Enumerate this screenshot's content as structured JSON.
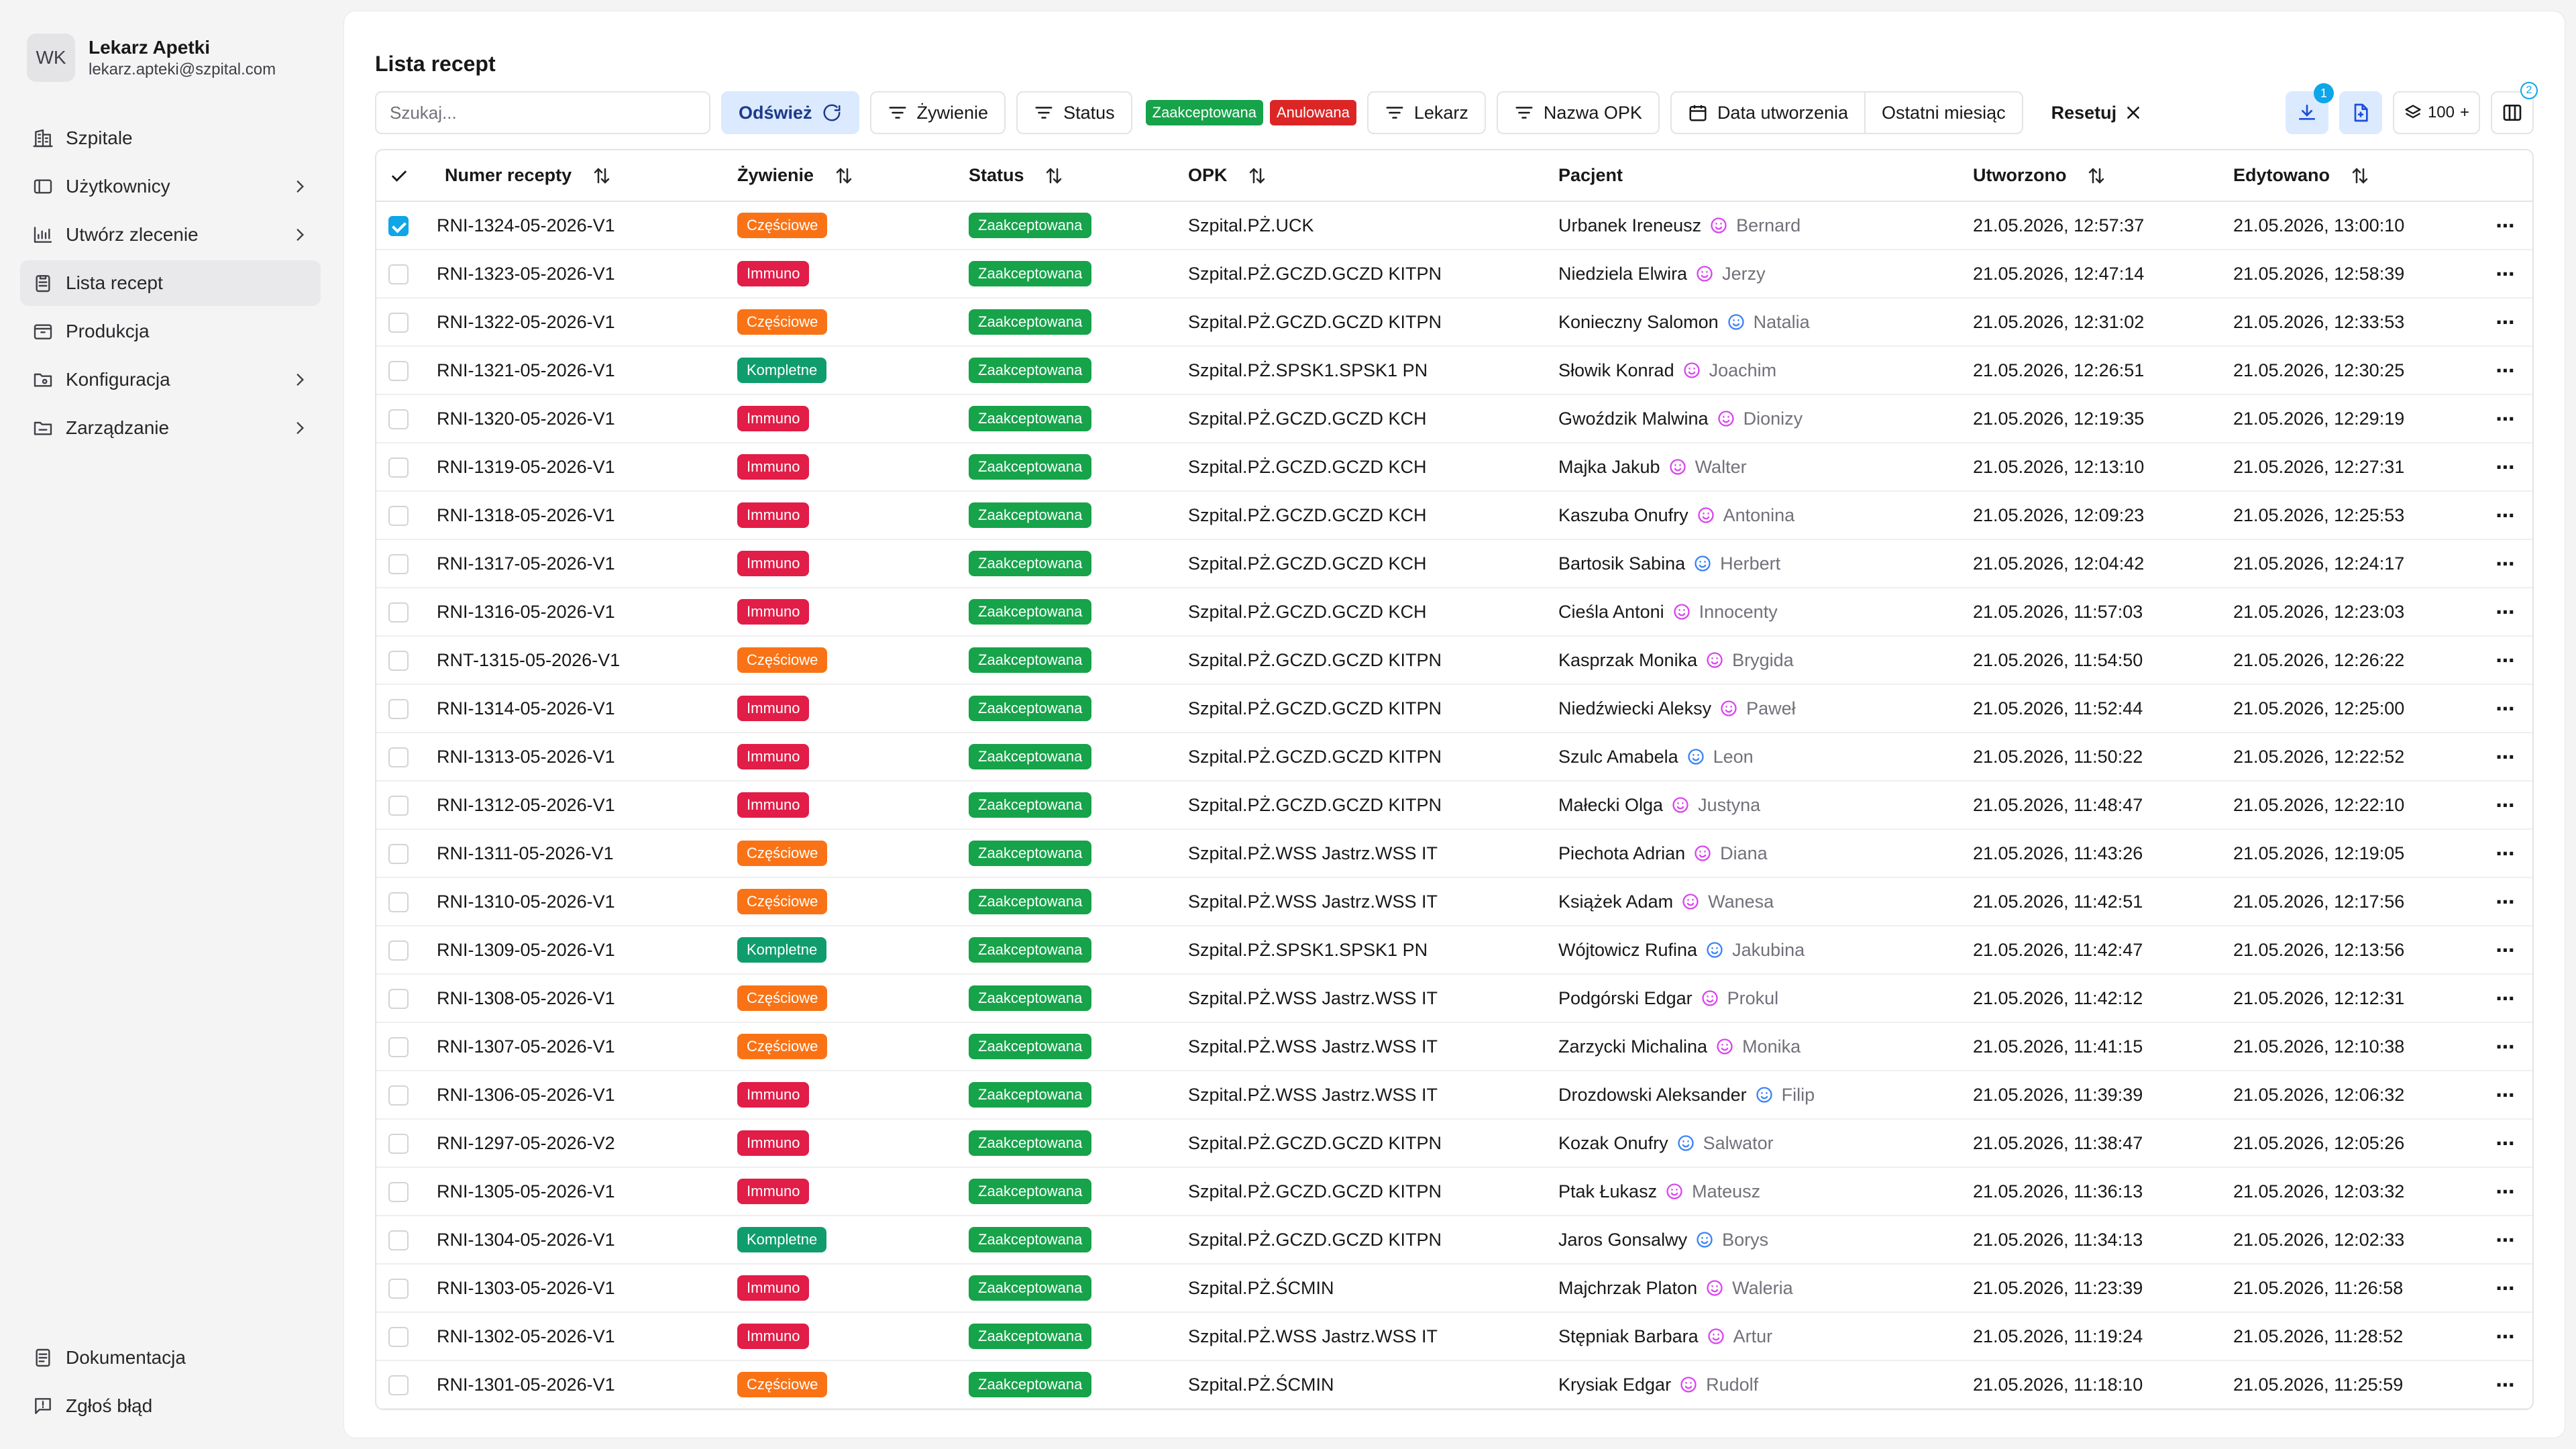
{
  "user": {
    "initials": "WK",
    "name": "Lekarz Apetki",
    "email": "lekarz.apteki@szpital.com"
  },
  "nav": [
    {
      "label": "Szpitale",
      "icon": "building-icon",
      "chevron": false
    },
    {
      "label": "Użytkownicy",
      "icon": "users-icon",
      "chevron": true
    },
    {
      "label": "Utwórz zlecenie",
      "icon": "chart-icon",
      "chevron": true
    },
    {
      "label": "Lista recept",
      "icon": "clipboard-icon",
      "chevron": false,
      "active": true
    },
    {
      "label": "Produkcja",
      "icon": "box-icon",
      "chevron": false
    },
    {
      "label": "Konfiguracja",
      "icon": "folder-gear-icon",
      "chevron": true
    },
    {
      "label": "Zarządzanie",
      "icon": "folder-icon",
      "chevron": true
    }
  ],
  "nav_bottom": [
    {
      "label": "Dokumentacja",
      "icon": "document-icon"
    },
    {
      "label": "Zgłoś błąd",
      "icon": "message-alert-icon"
    }
  ],
  "page_title": "Lista recept",
  "toolbar": {
    "search_placeholder": "Szukaj...",
    "refresh": "Odśwież",
    "diet": "Żywienie",
    "status": "Status",
    "status_chip_accepted": "Zaakceptowana",
    "status_chip_cancelled": "Anulowana",
    "doctor": "Lekarz",
    "opk_name": "Nazwa OPK",
    "created_date": "Data utworzenia",
    "last_month": "Ostatni miesiąc",
    "reset": "Resetuj",
    "download_badge": "1",
    "page_size": "100",
    "page_size_plus": "+",
    "columns_badge": "2"
  },
  "columns": {
    "number": "Numer recepty",
    "diet": "Żywienie",
    "status": "Status",
    "opk": "OPK",
    "patient": "Pacjent",
    "created": "Utworzono",
    "edited": "Edytowano"
  },
  "rows": [
    {
      "checked": true,
      "number": "RNI-1324-05-2026-V1",
      "diet": "Częściowe",
      "dietType": "partial",
      "status": "Zaakceptowana",
      "opk": "Szpital.PŻ.UCK",
      "patient": "Urbanek Ireneusz",
      "guardian": "Bernard",
      "gender": "f",
      "created": "21.05.2026, 12:57:37",
      "edited": "21.05.2026, 13:00:10"
    },
    {
      "checked": false,
      "number": "RNI-1323-05-2026-V1",
      "diet": "Immuno",
      "dietType": "immuno",
      "status": "Zaakceptowana",
      "opk": "Szpital.PŻ.GCZD.GCZD KITPN",
      "patient": "Niedziela Elwira",
      "guardian": "Jerzy",
      "gender": "f",
      "created": "21.05.2026, 12:47:14",
      "edited": "21.05.2026, 12:58:39"
    },
    {
      "checked": false,
      "number": "RNI-1322-05-2026-V1",
      "diet": "Częściowe",
      "dietType": "partial",
      "status": "Zaakceptowana",
      "opk": "Szpital.PŻ.GCZD.GCZD KITPN",
      "patient": "Konieczny Salomon",
      "guardian": "Natalia",
      "gender": "m",
      "created": "21.05.2026, 12:31:02",
      "edited": "21.05.2026, 12:33:53"
    },
    {
      "checked": false,
      "number": "RNI-1321-05-2026-V1",
      "diet": "Kompletne",
      "dietType": "complete",
      "status": "Zaakceptowana",
      "opk": "Szpital.PŻ.SPSK1.SPSK1 PN",
      "patient": "Słowik Konrad",
      "guardian": "Joachim",
      "gender": "f",
      "created": "21.05.2026, 12:26:51",
      "edited": "21.05.2026, 12:30:25"
    },
    {
      "checked": false,
      "number": "RNI-1320-05-2026-V1",
      "diet": "Immuno",
      "dietType": "immuno",
      "status": "Zaakceptowana",
      "opk": "Szpital.PŻ.GCZD.GCZD KCH",
      "patient": "Gwoździk Malwina",
      "guardian": "Dionizy",
      "gender": "f",
      "created": "21.05.2026, 12:19:35",
      "edited": "21.05.2026, 12:29:19"
    },
    {
      "checked": false,
      "number": "RNI-1319-05-2026-V1",
      "diet": "Immuno",
      "dietType": "immuno",
      "status": "Zaakceptowana",
      "opk": "Szpital.PŻ.GCZD.GCZD KCH",
      "patient": "Majka Jakub",
      "guardian": "Walter",
      "gender": "f",
      "created": "21.05.2026, 12:13:10",
      "edited": "21.05.2026, 12:27:31"
    },
    {
      "checked": false,
      "number": "RNI-1318-05-2026-V1",
      "diet": "Immuno",
      "dietType": "immuno",
      "status": "Zaakceptowana",
      "opk": "Szpital.PŻ.GCZD.GCZD KCH",
      "patient": "Kaszuba Onufry",
      "guardian": "Antonina",
      "gender": "f",
      "created": "21.05.2026, 12:09:23",
      "edited": "21.05.2026, 12:25:53"
    },
    {
      "checked": false,
      "number": "RNI-1317-05-2026-V1",
      "diet": "Immuno",
      "dietType": "immuno",
      "status": "Zaakceptowana",
      "opk": "Szpital.PŻ.GCZD.GCZD KCH",
      "patient": "Bartosik Sabina",
      "guardian": "Herbert",
      "gender": "m",
      "created": "21.05.2026, 12:04:42",
      "edited": "21.05.2026, 12:24:17"
    },
    {
      "checked": false,
      "number": "RNI-1316-05-2026-V1",
      "diet": "Immuno",
      "dietType": "immuno",
      "status": "Zaakceptowana",
      "opk": "Szpital.PŻ.GCZD.GCZD KCH",
      "patient": "Cieśla Antoni",
      "guardian": "Innocenty",
      "gender": "f",
      "created": "21.05.2026, 11:57:03",
      "edited": "21.05.2026, 12:23:03"
    },
    {
      "checked": false,
      "number": "RNT-1315-05-2026-V1",
      "diet": "Częściowe",
      "dietType": "partial",
      "status": "Zaakceptowana",
      "opk": "Szpital.PŻ.GCZD.GCZD KITPN",
      "patient": "Kasprzak Monika",
      "guardian": "Brygida",
      "gender": "f",
      "created": "21.05.2026, 11:54:50",
      "edited": "21.05.2026, 12:26:22"
    },
    {
      "checked": false,
      "number": "RNI-1314-05-2026-V1",
      "diet": "Immuno",
      "dietType": "immuno",
      "status": "Zaakceptowana",
      "opk": "Szpital.PŻ.GCZD.GCZD KITPN",
      "patient": "Niedźwiecki Aleksy",
      "guardian": "Paweł",
      "gender": "f",
      "created": "21.05.2026, 11:52:44",
      "edited": "21.05.2026, 12:25:00"
    },
    {
      "checked": false,
      "number": "RNI-1313-05-2026-V1",
      "diet": "Immuno",
      "dietType": "immuno",
      "status": "Zaakceptowana",
      "opk": "Szpital.PŻ.GCZD.GCZD KITPN",
      "patient": "Szulc Amabela",
      "guardian": "Leon",
      "gender": "m",
      "created": "21.05.2026, 11:50:22",
      "edited": "21.05.2026, 12:22:52"
    },
    {
      "checked": false,
      "number": "RNI-1312-05-2026-V1",
      "diet": "Immuno",
      "dietType": "immuno",
      "status": "Zaakceptowana",
      "opk": "Szpital.PŻ.GCZD.GCZD KITPN",
      "patient": "Małecki Olga",
      "guardian": "Justyna",
      "gender": "f",
      "created": "21.05.2026, 11:48:47",
      "edited": "21.05.2026, 12:22:10"
    },
    {
      "checked": false,
      "number": "RNI-1311-05-2026-V1",
      "diet": "Częściowe",
      "dietType": "partial",
      "status": "Zaakceptowana",
      "opk": "Szpital.PŻ.WSS Jastrz.WSS IT",
      "patient": "Piechota Adrian",
      "guardian": "Diana",
      "gender": "f",
      "created": "21.05.2026, 11:43:26",
      "edited": "21.05.2026, 12:19:05"
    },
    {
      "checked": false,
      "number": "RNI-1310-05-2026-V1",
      "diet": "Częściowe",
      "dietType": "partial",
      "status": "Zaakceptowana",
      "opk": "Szpital.PŻ.WSS Jastrz.WSS IT",
      "patient": "Książek Adam",
      "guardian": "Wanesa",
      "gender": "f",
      "created": "21.05.2026, 11:42:51",
      "edited": "21.05.2026, 12:17:56"
    },
    {
      "checked": false,
      "number": "RNI-1309-05-2026-V1",
      "diet": "Kompletne",
      "dietType": "complete",
      "status": "Zaakceptowana",
      "opk": "Szpital.PŻ.SPSK1.SPSK1 PN",
      "patient": "Wójtowicz Rufina",
      "guardian": "Jakubina",
      "gender": "m",
      "created": "21.05.2026, 11:42:47",
      "edited": "21.05.2026, 12:13:56"
    },
    {
      "checked": false,
      "number": "RNI-1308-05-2026-V1",
      "diet": "Częściowe",
      "dietType": "partial",
      "status": "Zaakceptowana",
      "opk": "Szpital.PŻ.WSS Jastrz.WSS IT",
      "patient": "Podgórski Edgar",
      "guardian": "Prokul",
      "gender": "f",
      "created": "21.05.2026, 11:42:12",
      "edited": "21.05.2026, 12:12:31"
    },
    {
      "checked": false,
      "number": "RNI-1307-05-2026-V1",
      "diet": "Częściowe",
      "dietType": "partial",
      "status": "Zaakceptowana",
      "opk": "Szpital.PŻ.WSS Jastrz.WSS IT",
      "patient": "Zarzycki Michalina",
      "guardian": "Monika",
      "gender": "f",
      "created": "21.05.2026, 11:41:15",
      "edited": "21.05.2026, 12:10:38"
    },
    {
      "checked": false,
      "number": "RNI-1306-05-2026-V1",
      "diet": "Immuno",
      "dietType": "immuno",
      "status": "Zaakceptowana",
      "opk": "Szpital.PŻ.WSS Jastrz.WSS IT",
      "patient": "Drozdowski Aleksander",
      "guardian": "Filip",
      "gender": "m",
      "created": "21.05.2026, 11:39:39",
      "edited": "21.05.2026, 12:06:32"
    },
    {
      "checked": false,
      "number": "RNI-1297-05-2026-V2",
      "diet": "Immuno",
      "dietType": "immuno",
      "status": "Zaakceptowana",
      "opk": "Szpital.PŻ.GCZD.GCZD KITPN",
      "patient": "Kozak Onufry",
      "guardian": "Salwator",
      "gender": "m",
      "created": "21.05.2026, 11:38:47",
      "edited": "21.05.2026, 12:05:26"
    },
    {
      "checked": false,
      "number": "RNI-1305-05-2026-V1",
      "diet": "Immuno",
      "dietType": "immuno",
      "status": "Zaakceptowana",
      "opk": "Szpital.PŻ.GCZD.GCZD KITPN",
      "patient": "Ptak Łukasz",
      "guardian": "Mateusz",
      "gender": "f",
      "created": "21.05.2026, 11:36:13",
      "edited": "21.05.2026, 12:03:32"
    },
    {
      "checked": false,
      "number": "RNI-1304-05-2026-V1",
      "diet": "Kompletne",
      "dietType": "complete",
      "status": "Zaakceptowana",
      "opk": "Szpital.PŻ.GCZD.GCZD KITPN",
      "patient": "Jaros Gonsalwy",
      "guardian": "Borys",
      "gender": "m",
      "created": "21.05.2026, 11:34:13",
      "edited": "21.05.2026, 12:02:33"
    },
    {
      "checked": false,
      "number": "RNI-1303-05-2026-V1",
      "diet": "Immuno",
      "dietType": "immuno",
      "status": "Zaakceptowana",
      "opk": "Szpital.PŻ.ŚCMIN",
      "patient": "Majchrzak Platon",
      "guardian": "Waleria",
      "gender": "f",
      "created": "21.05.2026, 11:23:39",
      "edited": "21.05.2026, 11:26:58"
    },
    {
      "checked": false,
      "number": "RNI-1302-05-2026-V1",
      "diet": "Immuno",
      "dietType": "immuno",
      "status": "Zaakceptowana",
      "opk": "Szpital.PŻ.WSS Jastrz.WSS IT",
      "patient": "Stępniak Barbara",
      "guardian": "Artur",
      "gender": "f",
      "created": "21.05.2026, 11:19:24",
      "edited": "21.05.2026, 11:28:52"
    },
    {
      "checked": false,
      "number": "RNI-1301-05-2026-V1",
      "diet": "Częściowe",
      "dietType": "partial",
      "status": "Zaakceptowana",
      "opk": "Szpital.PŻ.ŚCMIN",
      "patient": "Krysiak Edgar",
      "guardian": "Rudolf",
      "gender": "f",
      "created": "21.05.2026, 11:18:10",
      "edited": "21.05.2026, 11:25:59"
    }
  ],
  "colors": {
    "accent": "#0ea5e9",
    "partial": "#f97316",
    "immuno": "#e11d48",
    "complete": "#0f9d6e",
    "accepted": "#16a34a",
    "cancelled": "#dc2626",
    "patient_icon_female": "#d946ef",
    "patient_icon_male": "#3b82f6"
  }
}
